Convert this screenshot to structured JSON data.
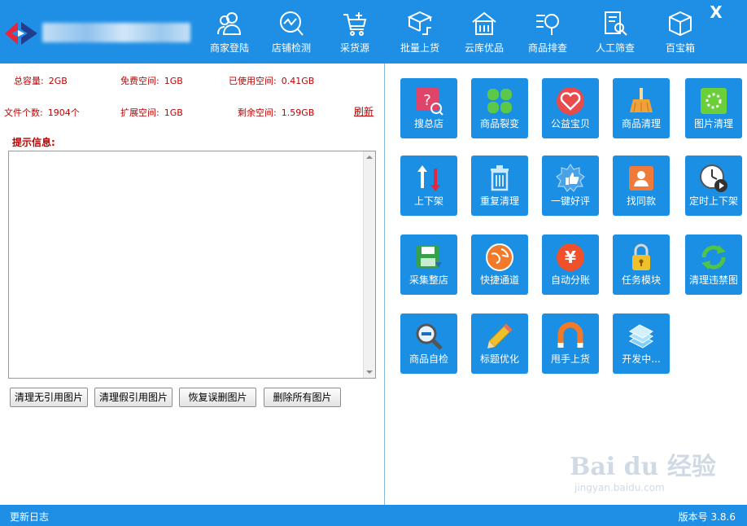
{
  "topnav": [
    {
      "label": "商家登陆",
      "icon": "people-icon"
    },
    {
      "label": "店铺检测",
      "icon": "chart-search-icon"
    },
    {
      "label": "采货源",
      "icon": "cart-add-icon"
    },
    {
      "label": "批量上货",
      "icon": "box-upload-icon"
    },
    {
      "label": "云库优品",
      "icon": "warehouse-icon"
    },
    {
      "label": "商品排查",
      "icon": "list-search-icon"
    },
    {
      "label": "人工筛查",
      "icon": "document-search-icon"
    },
    {
      "label": "百宝箱",
      "icon": "toolbox-icon"
    }
  ],
  "window": {
    "close": "X"
  },
  "storage": {
    "total_label": "总容量:",
    "total": "2GB",
    "free_label": "免费空间:",
    "free": "1GB",
    "used_label": "已使用空间:",
    "used": "0.41GB",
    "files_label": "文件个数:",
    "files": "1904个",
    "ext_label": "扩展空间:",
    "ext": "1GB",
    "remain_label": "剩余空间:",
    "remain": "1.59GB",
    "refresh": "刷新"
  },
  "hint": {
    "title": "提示信息:"
  },
  "buttons": {
    "clean_unref": "清理无引用图片",
    "clean_fake": "清理假引用图片",
    "restore": "恢复误删图片",
    "delete_all": "删除所有图片"
  },
  "tiles": [
    {
      "label": "搜总店",
      "icon": "search-store-icon",
      "bg": "#e0446b"
    },
    {
      "label": "商品裂变",
      "icon": "clover-icon",
      "bg": "#5cc84a"
    },
    {
      "label": "公益宝贝",
      "icon": "heart-icon",
      "bg": "#e84b4b"
    },
    {
      "label": "商品清理",
      "icon": "broom-icon",
      "bg": "#f0a23a"
    },
    {
      "label": "图片清理",
      "icon": "image-clean-icon",
      "bg": "#6bcf3a"
    },
    {
      "label": "上下架",
      "icon": "updown-arrows-icon",
      "bg": "#ffffff"
    },
    {
      "label": "重复清理",
      "icon": "trash-icon",
      "bg": "#9fd4f8"
    },
    {
      "label": "一键好评",
      "icon": "thumbs-up-icon",
      "bg": "#4aa3e8"
    },
    {
      "label": "找同款",
      "icon": "person-card-icon",
      "bg": "#f07a3a"
    },
    {
      "label": "定时上下架",
      "icon": "clock-play-icon",
      "bg": "#ffffff"
    },
    {
      "label": "采集整店",
      "icon": "save-disk-icon",
      "bg": "#36a04a"
    },
    {
      "label": "快捷通道",
      "icon": "globe-icon",
      "bg": "#f07a2a"
    },
    {
      "label": "自动分账",
      "icon": "yuan-coin-icon",
      "bg": "#f0502a"
    },
    {
      "label": "任务模块",
      "icon": "padlock-icon",
      "bg": "#f0c02a"
    },
    {
      "label": "清理违禁图",
      "icon": "refresh-cycle-icon",
      "bg": "#4fc34a"
    },
    {
      "label": "商品自检",
      "icon": "magnifier-minus-icon",
      "bg": "#ffffff"
    },
    {
      "label": "标题优化",
      "icon": "pencil-icon",
      "bg": "#f0c02a"
    },
    {
      "label": "甩手上货",
      "icon": "magnet-icon",
      "bg": "#f07a2a"
    },
    {
      "label": "开发中...",
      "icon": "books-icon",
      "bg": "#7fd0f8"
    }
  ],
  "watermark": {
    "brand": "Bai du 经验",
    "url": "jingyan.baidu.com"
  },
  "status": {
    "log": "更新日志",
    "version": "版本号 3.8.6"
  },
  "colors": {
    "primary": "#1f8fe6",
    "tile": "#1a8fe3",
    "alert_text": "#c00000"
  }
}
